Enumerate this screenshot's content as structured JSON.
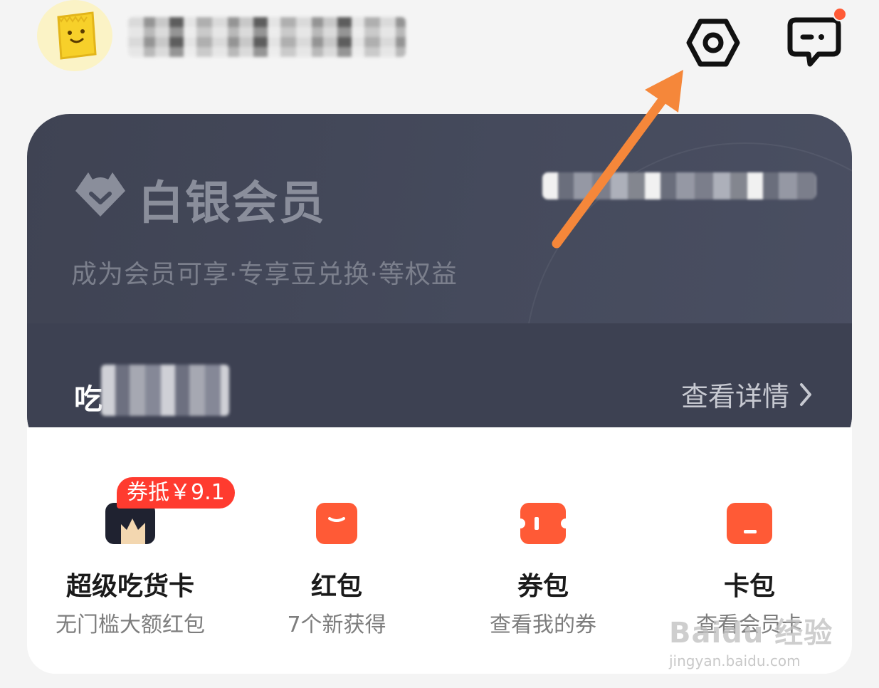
{
  "header": {
    "username_masked": "",
    "icons": [
      "avatar-icon",
      "settings-icon",
      "message-icon"
    ]
  },
  "member_card": {
    "tier_name": "白银会员",
    "subtitle": "成为会员可享·专享豆兑换·等权益",
    "lower_left_prefix": "吃",
    "view_details": "查看详情"
  },
  "quick_access": [
    {
      "title": "超级吃货卡",
      "subtitle": "无门槛大额红包",
      "badge": "券抵￥9.1",
      "icon": "crown-icon"
    },
    {
      "title": "红包",
      "subtitle": "7个新获得",
      "icon": "red-packet-icon"
    },
    {
      "title": "券包",
      "subtitle": "查看我的券",
      "icon": "coupon-icon"
    },
    {
      "title": "卡包",
      "subtitle": "查看会员卡",
      "icon": "card-wallet-icon"
    }
  ],
  "watermark": {
    "logo": "Baidu 经验",
    "url": "jingyan.baidu.com"
  },
  "colors": {
    "accent": "#ff5a36",
    "card_bg": "#3f4353",
    "annotation": "#f5873a"
  }
}
